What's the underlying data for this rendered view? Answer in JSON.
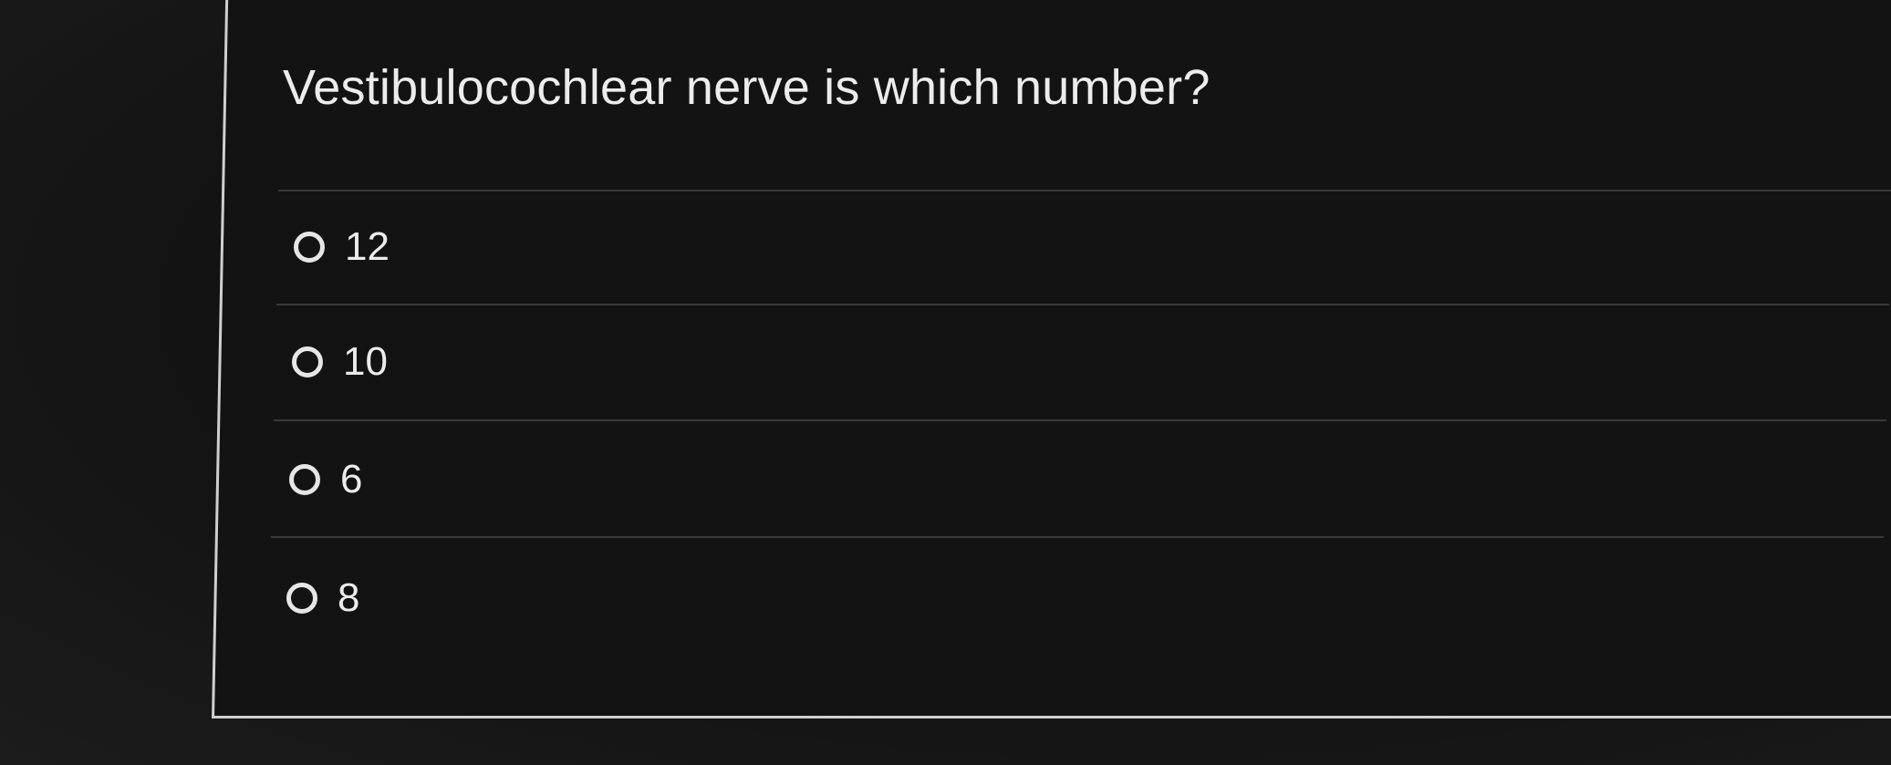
{
  "question": {
    "text": "Vestibulocochlear nerve is which number?"
  },
  "options": [
    {
      "label": "12",
      "selected": false
    },
    {
      "label": "10",
      "selected": false
    },
    {
      "label": "6",
      "selected": false
    },
    {
      "label": "8",
      "selected": false
    }
  ],
  "colors": {
    "background": "#131313",
    "text": "#ececec",
    "divider": "#3a3a3a",
    "border": "#cfcfcf"
  }
}
